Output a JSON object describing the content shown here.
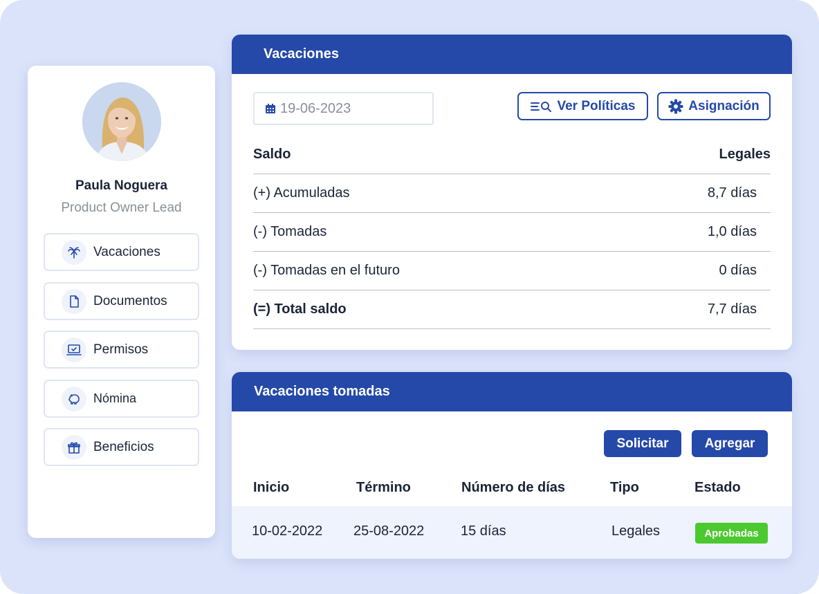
{
  "profile": {
    "name": "Paula Noguera",
    "role": "Product Owner Lead",
    "nav": [
      {
        "label": "Vacaciones",
        "icon": "palm-tree-icon"
      },
      {
        "label": "Documentos",
        "icon": "document-icon"
      },
      {
        "label": "Permisos",
        "icon": "laptop-check-icon"
      },
      {
        "label": "Nómina",
        "icon": "piggy-bank-icon"
      },
      {
        "label": "Beneficios",
        "icon": "gift-icon"
      }
    ]
  },
  "vacaciones": {
    "title": "Vacaciones",
    "date_value": "19-06-2023",
    "ver_politicas_label": "Ver Políticas",
    "asignacion_label": "Asignación",
    "header": {
      "label": "Saldo",
      "column": "Legales"
    },
    "rows": [
      {
        "label": "(+) Acumuladas",
        "amount": "8,7 días"
      },
      {
        "label": "(-) Tomadas",
        "amount": "1,0 días"
      },
      {
        "label": "(-) Tomadas en el futuro",
        "amount": "0 días"
      },
      {
        "label": "(=) Total saldo",
        "amount": "7,7 días"
      }
    ]
  },
  "tomadas": {
    "title": "Vacaciones tomadas",
    "solicitar_label": "Solicitar",
    "agregar_label": "Agregar",
    "columns": [
      "Inicio",
      "Término",
      "Número de días",
      "Tipo",
      "Estado"
    ],
    "rows": [
      {
        "inicio": "10-02-2022",
        "termino": "25-08-2022",
        "dias": "15 días",
        "tipo": "Legales",
        "estado": "Aprobadas"
      }
    ]
  },
  "colors": {
    "accent": "#2549a9",
    "background": "#dbe3fb",
    "status_approved": "#4cc92f"
  }
}
